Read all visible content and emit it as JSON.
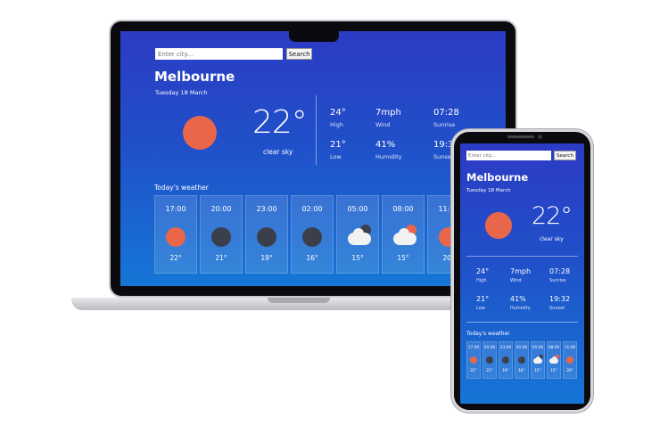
{
  "app": {
    "search_placeholder": "Enter city...",
    "search_button": "Search",
    "city": "Melbourne",
    "date": "Tuesday 18 March",
    "temperature": "22°",
    "condition": "clear sky",
    "stats": [
      {
        "value": "24°",
        "label": "High"
      },
      {
        "value": "7mph",
        "label": "Wind"
      },
      {
        "value": "07:28",
        "label": "Sunrise"
      },
      {
        "value": "21°",
        "label": "Low"
      },
      {
        "value": "41%",
        "label": "Humidity"
      },
      {
        "value": "19:32",
        "label": "Sunset"
      }
    ],
    "today_label": "Today's weather",
    "hourly": [
      {
        "time": "17:00",
        "temp": "22°",
        "icon": "sun-icon"
      },
      {
        "time": "20:00",
        "temp": "21°",
        "icon": "moon-icon"
      },
      {
        "time": "23:00",
        "temp": "19°",
        "icon": "moon-icon"
      },
      {
        "time": "02:00",
        "temp": "16°",
        "icon": "moon-icon"
      },
      {
        "time": "05:00",
        "temp": "15°",
        "icon": "cloudy-night-icon"
      },
      {
        "time": "08:00",
        "temp": "15°",
        "icon": "partly-cloudy-icon"
      },
      {
        "time": "11:00",
        "temp": "20°",
        "icon": "sun-icon"
      }
    ]
  },
  "colors": {
    "sun": "#e9664a",
    "moon": "#3b3f4b",
    "background_top": "#2c3bc4",
    "background_bottom": "#1576d6"
  }
}
